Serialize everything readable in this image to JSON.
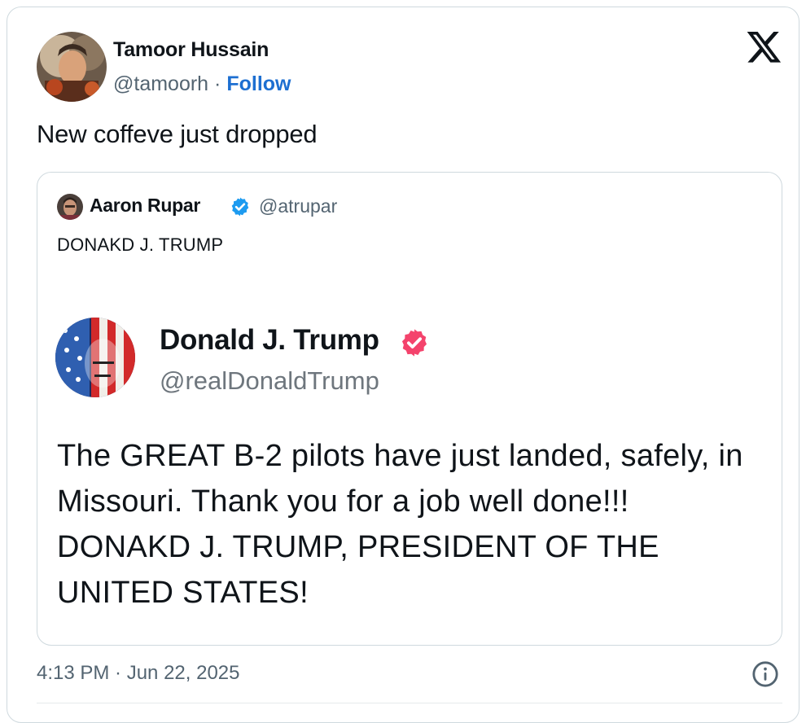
{
  "author": {
    "name": "Tamoor Hussain",
    "handle": "@tamoorh",
    "separator": "·",
    "follow_label": "Follow"
  },
  "tweet": {
    "text": "New coffeve just dropped",
    "timestamp": "4:13 PM · Jun 22, 2025"
  },
  "quote": {
    "name": "Aaron Rupar",
    "handle": "@atrupar",
    "text": "DONAKD J. TRUMP",
    "embed": {
      "name": "Donald J. Trump",
      "handle": "@realDonaldTrump",
      "body": "The GREAT B-2 pilots have just landed, safely, in Missouri. Thank you for a job well done!!! DONAKD J. TRUMP, PRESIDENT OF THE UNITED STATES!"
    }
  },
  "icons": {
    "brand": "x-logo-icon",
    "verified": "verified-badge-icon",
    "info": "info-icon"
  },
  "colors": {
    "link_blue": "#1d6fd1",
    "verified_blue": "#1d9bf0",
    "verified_pink": "#f4436c",
    "muted_text": "#536471",
    "border": "#cfd9de"
  }
}
